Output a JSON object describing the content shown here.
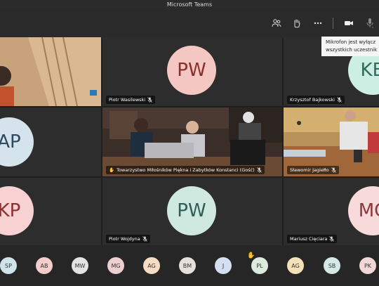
{
  "window": {
    "title": "Microsoft Teams"
  },
  "toolbar": {
    "buttons": [
      "participants-icon",
      "raise-hand-icon",
      "more-options-icon",
      "camera-icon",
      "microphone-icon"
    ]
  },
  "tooltip": {
    "line1": "Mikrofon jest wyłącz",
    "line2": "wszystkich uczestnik"
  },
  "tiles": {
    "video_top_left": {
      "name": ""
    },
    "piotr_wasilewski": {
      "initials": "PW",
      "name": "Piotr Wasilewski",
      "avatar_bg": "#f4c7c3",
      "avatar_fg": "#8a2e2a"
    },
    "krzysztof_bajkowski": {
      "initials": "KB",
      "name": "Krzysztof Bajkowski",
      "avatar_bg": "#cdeee3",
      "avatar_fg": "#2f6b5c"
    },
    "ap": {
      "initials": "AP",
      "avatar_bg": "#d5e3ec",
      "avatar_fg": "#2d4a60"
    },
    "towarzystwo": {
      "name": "Towarzystwo Miłośników Piękna i Zabytków Konstanci (Gość)"
    },
    "slawomir_jagiello": {
      "name": "Sławomir Jagiełło"
    },
    "kp": {
      "initials": "KP",
      "avatar_bg": "#f8d2d2",
      "avatar_fg": "#8c3030"
    },
    "piotr_wojdyna": {
      "initials": "PW",
      "name": "Piotr Wojdyna",
      "avatar_bg": "#cfe8e0",
      "avatar_fg": "#2f5e52"
    },
    "mariusz_ciecara": {
      "initials": "MC",
      "name": "Mariusz Cięciara",
      "avatar_bg": "#f8dada",
      "avatar_fg": "#8c3838"
    }
  },
  "strip": {
    "participants": [
      {
        "initials": "SP",
        "bg": "#cfe3ea"
      },
      {
        "initials": "AB",
        "bg": "#f3cccc"
      },
      {
        "initials": "MW",
        "bg": "#e3e3e3"
      },
      {
        "initials": "MG",
        "bg": "#eecfcf"
      },
      {
        "initials": "AG",
        "bg": "#f7dcc4"
      },
      {
        "initials": "BM",
        "bg": "#e6e0dc"
      },
      {
        "initials": "J",
        "bg": "#d5dff2"
      },
      {
        "initials": "PL",
        "bg": "#dceadd"
      },
      {
        "initials": "AG",
        "bg": "#f5e0b8"
      },
      {
        "initials": "SB",
        "bg": "#d4e8e6"
      },
      {
        "initials": "PK",
        "bg": "#f3d6d6"
      }
    ]
  },
  "colors": {
    "hand": "#f0b429",
    "background": "#1f1f1f",
    "tile": "#2d2d2d"
  }
}
